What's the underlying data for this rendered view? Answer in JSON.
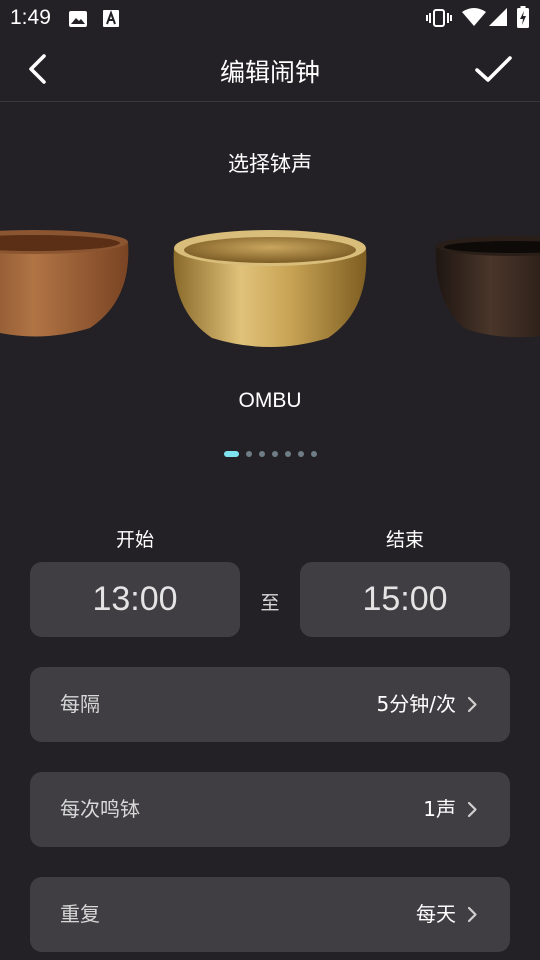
{
  "status_bar": {
    "time": "1:49",
    "left_icons": [
      "image-icon",
      "text-a-icon"
    ],
    "right_icons": [
      "vibrate-icon",
      "wifi-icon",
      "signal-icon",
      "battery-charging-icon"
    ]
  },
  "app_bar": {
    "title": "编辑闹钟",
    "back_icon": "chevron-left-icon",
    "confirm_icon": "checkmark-icon"
  },
  "bowl_picker": {
    "title": "选择钵声",
    "selected_name": "OMBU",
    "page_count": 7,
    "active_page": 0
  },
  "time_range": {
    "start_label": "开始",
    "start_value": "13:00",
    "to_label": "至",
    "end_label": "结束",
    "end_value": "15:00"
  },
  "settings": [
    {
      "label": "每隔",
      "value": "5分钟/次"
    },
    {
      "label": "每次鸣钵",
      "value": "1声"
    },
    {
      "label": "重复",
      "value": "每天"
    }
  ],
  "colors": {
    "background": "#232125",
    "card": "#403e42",
    "accent_dot": "#7ee3ee",
    "inactive_dot": "#6f7e86"
  }
}
